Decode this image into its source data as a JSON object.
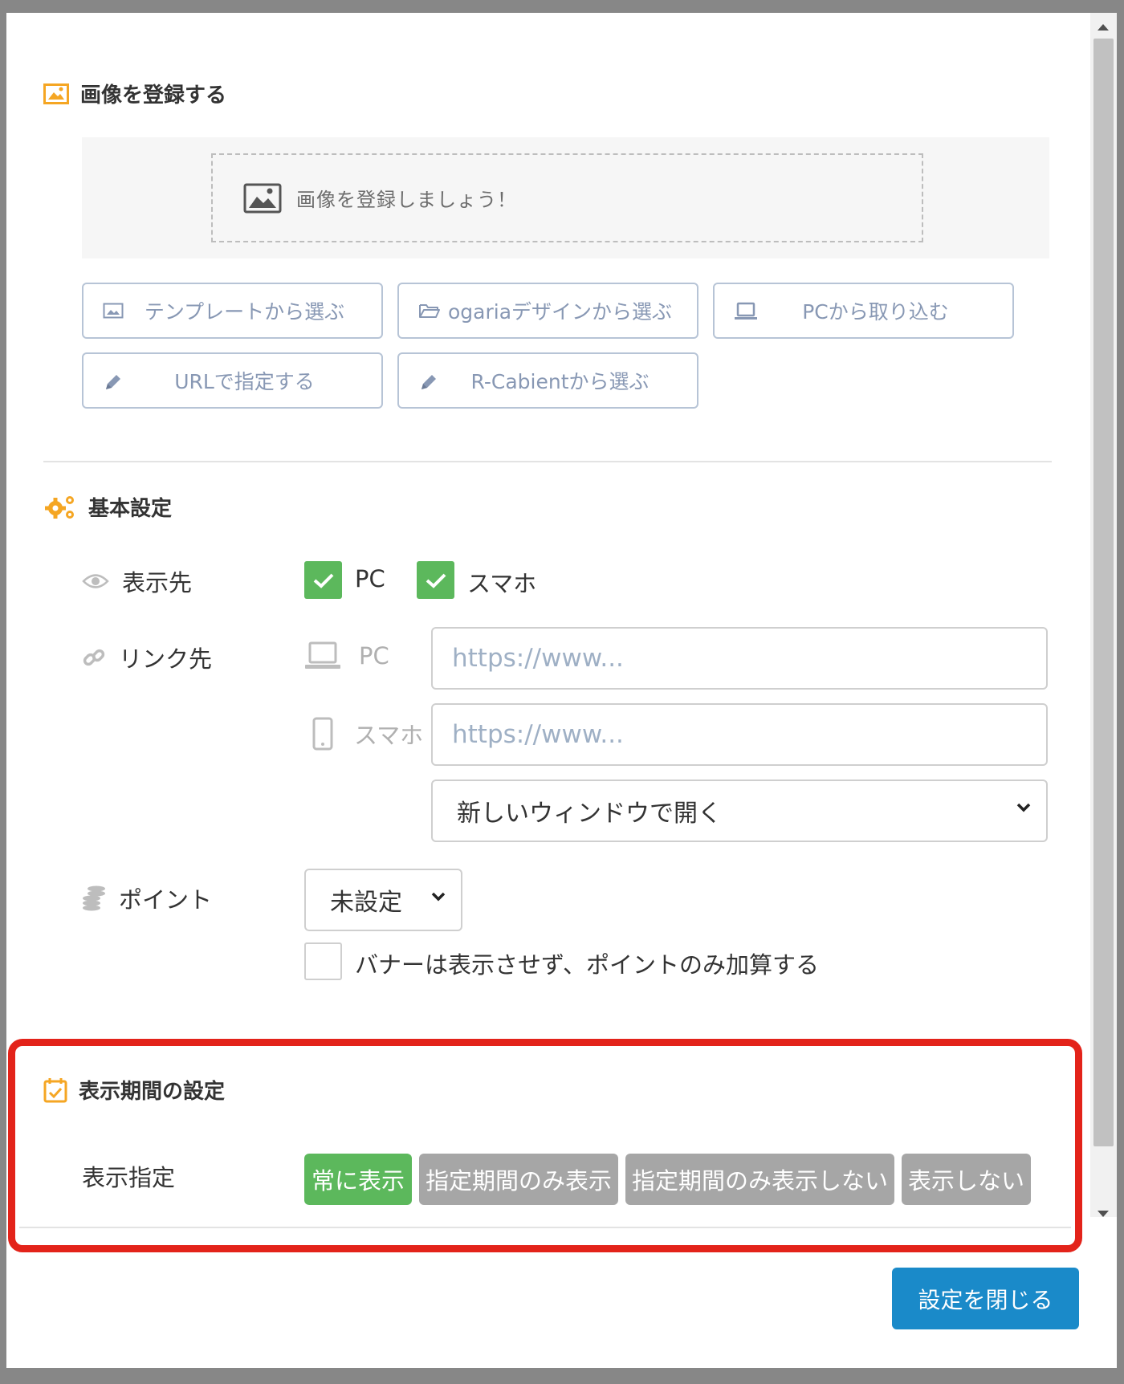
{
  "image_section": {
    "title": "画像を登録する",
    "dropzone_text": "画像を登録しましょう！",
    "buttons": [
      {
        "label": "テンプレートから選ぶ",
        "icon": "image-icon"
      },
      {
        "label": "ogariaデザインから選ぶ",
        "icon": "folder-open-icon"
      },
      {
        "label": "PCから取り込む",
        "icon": "laptop-icon"
      },
      {
        "label": "URLで指定する",
        "icon": "pencil-icon"
      },
      {
        "label": "R-Cabientから選ぶ",
        "icon": "pencil-icon"
      }
    ]
  },
  "basic_section": {
    "title": "基本設定",
    "display_target": {
      "label": "表示先",
      "options": [
        {
          "label": "PC",
          "checked": true
        },
        {
          "label": "スマホ",
          "checked": true
        }
      ]
    },
    "link": {
      "label": "リンク先",
      "pc_label": "PC",
      "sp_label": "スマホ",
      "pc_placeholder": "https://www...",
      "sp_placeholder": "https://www...",
      "window_option": "新しいウィンドウで開く"
    },
    "point": {
      "label": "ポイント",
      "select_value": "未設定",
      "checkbox_label": "バナーは表示させず、ポイントのみ加算する",
      "checkbox_checked": false
    }
  },
  "period_section": {
    "title": "表示期間の設定",
    "label": "表示指定",
    "options": [
      "常に表示",
      "指定期間のみ表示",
      "指定期間のみ表示しない",
      "表示しない"
    ],
    "selected": "常に表示"
  },
  "footer": {
    "close_label": "設定を閉じる"
  },
  "colors": {
    "accent_orange": "#f5a623",
    "success_green": "#5cb85c",
    "primary_blue": "#1a8ac9",
    "highlight_red": "#e3231a"
  }
}
